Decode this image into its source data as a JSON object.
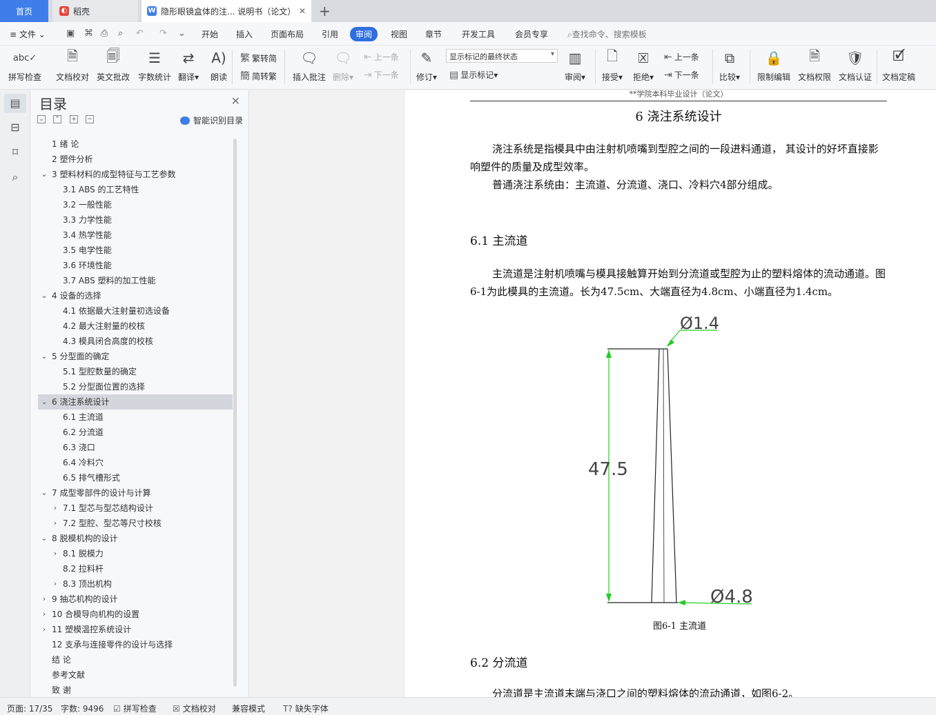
{
  "tabs": {
    "home": "首页",
    "daoke": "稻壳",
    "doc": "隐形眼镜盒体的注... 说明书（论文）"
  },
  "menu": {
    "file": "文件",
    "items": [
      "开始",
      "插入",
      "页面布局",
      "引用",
      "审阅",
      "视图",
      "章节",
      "开发工具",
      "会员专享"
    ],
    "search": "查找命令、搜索模板"
  },
  "ribbon": {
    "spellcheck": "拼写检查",
    "doc_proof": "文档校对",
    "en_correct": "英文批改",
    "word_count": "字数统计",
    "translate": "翻译",
    "read_aloud": "朗读",
    "trad_convert": "繁转简",
    "simp_convert": "简转繁",
    "insert_comment": "插入批注",
    "delete": "删除",
    "prev_comment": "上一条",
    "next_comment": "下一条",
    "track_changes": "修订",
    "markup_state": "显示标记的最终状态",
    "show_markup": "显示标记",
    "review": "审阅",
    "accept": "接受",
    "reject": "拒绝",
    "prev_change": "上一条",
    "next_change": "下一条",
    "compare": "比较",
    "restrict_edit": "限制编辑",
    "doc_permission": "文档权限",
    "doc_cert": "文档认证",
    "doc_finalize": "文档定稿"
  },
  "toc": {
    "title": "目录",
    "smart": "智能识别目录",
    "items": [
      {
        "text": "1  绪  论",
        "level": 1,
        "chev": ""
      },
      {
        "text": "2  塑件分析",
        "level": 1,
        "chev": ""
      },
      {
        "text": "3  塑料材料的成型特征与工艺参数",
        "level": 1,
        "chev": "down"
      },
      {
        "text": "3.1 ABS 的工艺特性",
        "level": 2,
        "chev": ""
      },
      {
        "text": "3.2  一般性能",
        "level": 2,
        "chev": ""
      },
      {
        "text": "3.3  力学性能",
        "level": 2,
        "chev": ""
      },
      {
        "text": "3.4  热学性能",
        "level": 2,
        "chev": ""
      },
      {
        "text": "3.5  电学性能",
        "level": 2,
        "chev": ""
      },
      {
        "text": "3.6  环境性能",
        "level": 2,
        "chev": ""
      },
      {
        "text": "3.7 ABS 塑料的加工性能",
        "level": 2,
        "chev": ""
      },
      {
        "text": "4  设备的选择",
        "level": 1,
        "chev": "down"
      },
      {
        "text": "4.1  依据最大注射量初选设备",
        "level": 2,
        "chev": ""
      },
      {
        "text": "4.2  最大注射量的校核",
        "level": 2,
        "chev": ""
      },
      {
        "text": "4.3  模具闭合高度的校核",
        "level": 2,
        "chev": ""
      },
      {
        "text": "5  分型面的确定",
        "level": 1,
        "chev": "down"
      },
      {
        "text": "5.1  型腔数量的确定",
        "level": 2,
        "chev": ""
      },
      {
        "text": "5.2  分型面位置的选择",
        "level": 2,
        "chev": ""
      },
      {
        "text": "6  浇注系统设计",
        "level": 1,
        "chev": "down",
        "selected": true
      },
      {
        "text": "6.1  主流道",
        "level": 2,
        "chev": ""
      },
      {
        "text": "6.2  分流道",
        "level": 2,
        "chev": ""
      },
      {
        "text": "6.3  浇口",
        "level": 2,
        "chev": ""
      },
      {
        "text": "6.4  冷料穴",
        "level": 2,
        "chev": ""
      },
      {
        "text": "6.5  排气槽形式",
        "level": 2,
        "chev": ""
      },
      {
        "text": "7  成型零部件的设计与计算",
        "level": 1,
        "chev": "down"
      },
      {
        "text": "7.1  型芯与型芯结构设计",
        "level": 2,
        "chev": "right"
      },
      {
        "text": "7.2  型腔、型芯等尺寸校核",
        "level": 2,
        "chev": "right"
      },
      {
        "text": "8  脱模机构的设计",
        "level": 1,
        "chev": "down"
      },
      {
        "text": "8.1  脱模力",
        "level": 2,
        "chev": "right"
      },
      {
        "text": "8.2  拉料杆",
        "level": 2,
        "chev": ""
      },
      {
        "text": "8.3  顶出机构",
        "level": 2,
        "chev": "right"
      },
      {
        "text": "9  抽芯机构的设计",
        "level": 1,
        "chev": "right"
      },
      {
        "text": "10  合模导向机构的设置",
        "level": 1,
        "chev": "right"
      },
      {
        "text": "11  塑模温控系统设计",
        "level": 1,
        "chev": "right"
      },
      {
        "text": "12  支承与连接零件的设计与选择",
        "level": 1,
        "chev": ""
      },
      {
        "text": "结  论",
        "level": 1,
        "chev": ""
      },
      {
        "text": "参考文献",
        "level": 1,
        "chev": ""
      },
      {
        "text": "致  谢",
        "level": 1,
        "chev": ""
      }
    ]
  },
  "page": {
    "header": "**学院本科毕业设计（论文）",
    "chapter_title": "6  浇注系统设计",
    "p1": "浇注系统是指模具中由注射机喷嘴到型腔之间的一段进料通道，  其设计的好坏直接影响塑件的质量及成型效率。",
    "p2": "普通浇注系统由：主流道、分流道、浇口、冷料穴4部分组成。",
    "sec1": "6.1  主流道",
    "p3": "主流道是注射机喷嘴与模具接触算开始到分流道或型腔为止的塑料熔体的流动通道。图6-1为此模具的主流道。长为47.5cm、大端直径为4.8cm、小端直径为1.4cm。",
    "dim_top": "Ø1.4",
    "dim_len": "47.5",
    "dim_bottom": "Ø4.8",
    "fig_caption": "图6-1  主流道",
    "sec2": "6.2  分流道",
    "p4": "分流道是主流道末端与浇口之间的塑料熔体的流动通道，如图6-2。"
  },
  "status": {
    "page": "页面: 17/35",
    "words": "字数: 9496",
    "spell": "拼写检查",
    "proof": "文档校对",
    "compat": "兼容模式",
    "missing_font": "缺失字体"
  },
  "colors": {
    "accent": "#2f6fe0",
    "dimension": "#22cc22"
  }
}
